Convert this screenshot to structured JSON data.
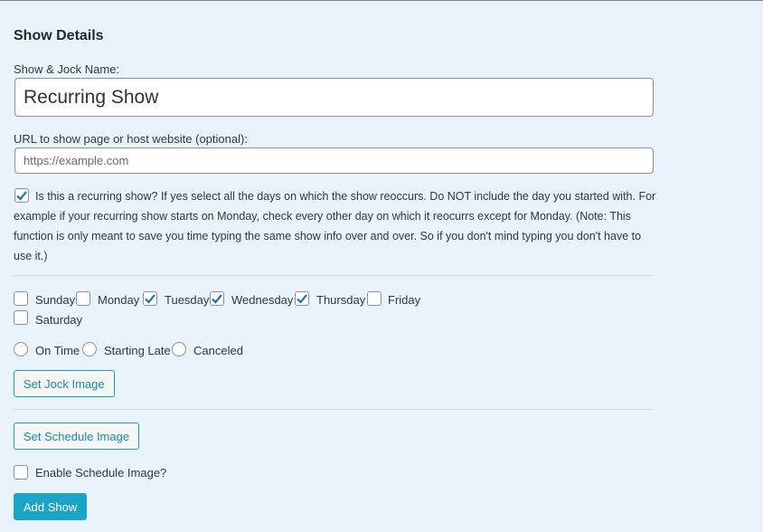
{
  "section_title": "Show Details",
  "name_field": {
    "label": "Show & Jock Name:",
    "value": "Recurring Show"
  },
  "url_field": {
    "label": "URL to show page or host website (optional):",
    "placeholder": "https://example.com"
  },
  "recurring": {
    "checked": true,
    "text": "Is this a recurring show? If yes select all the days on which the show reoccurs. Do NOT include the day you started with. For example if your recurring show starts on Monday, check every other day on which it reocurrs except for Monday. (Note: This function is only meant to save you time typing the same show info over and over. So if you don't mind typing you don't have to use it.)"
  },
  "days": [
    {
      "label": "Sunday",
      "checked": false
    },
    {
      "label": "Monday",
      "checked": false
    },
    {
      "label": "Tuesday",
      "checked": true
    },
    {
      "label": "Wednesday",
      "checked": true
    },
    {
      "label": "Thursday",
      "checked": true
    },
    {
      "label": "Friday",
      "checked": false
    },
    {
      "label": "Saturday",
      "checked": false
    }
  ],
  "statuses": [
    {
      "label": "On Time",
      "selected": false
    },
    {
      "label": "Starting Late",
      "selected": false
    },
    {
      "label": "Canceled",
      "selected": false
    }
  ],
  "buttons": {
    "jock_image": "Set Jock Image",
    "schedule_image": "Set Schedule Image",
    "add_show": "Add Show"
  },
  "enable_schedule_image": {
    "label": "Enable Schedule Image?",
    "checked": false
  },
  "colors": {
    "accent": "#1aa5c8",
    "check": "#1e73a8",
    "background": "#e8f3fc"
  }
}
